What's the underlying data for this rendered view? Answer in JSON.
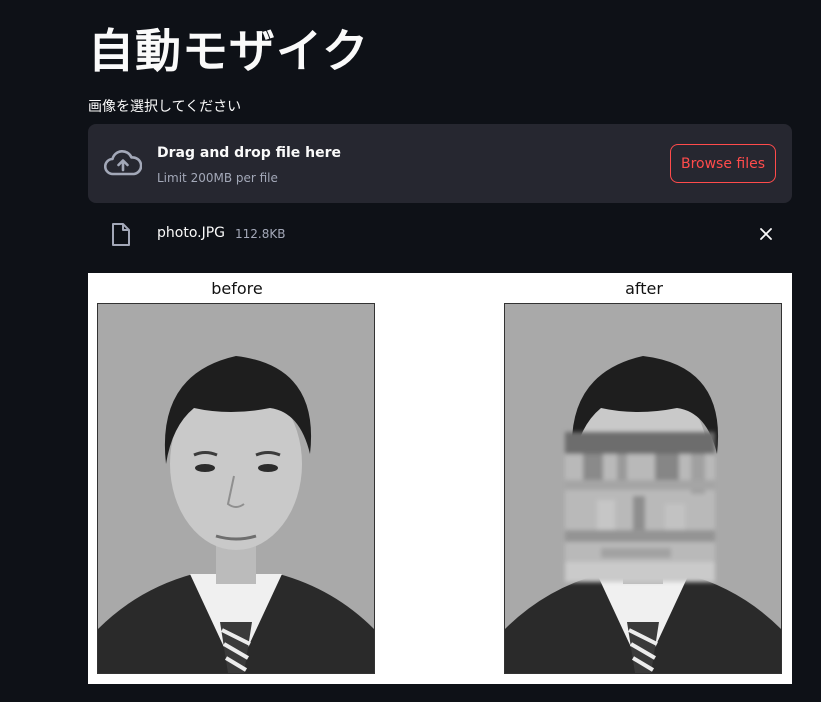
{
  "page": {
    "title": "自動モザイク"
  },
  "uploader": {
    "label": "画像を選択してください",
    "dropzone_title": "Drag and drop file here",
    "dropzone_limit": "Limit 200MB per file",
    "browse_label": "Browse files",
    "upload_icon": "cloud-upload-icon"
  },
  "uploaded_file": {
    "name": "photo.JPG",
    "size": "112.8KB",
    "file_icon": "file-icon",
    "remove_icon": "close-icon"
  },
  "figure": {
    "panels": [
      {
        "title": "before",
        "mosaic": false
      },
      {
        "title": "after",
        "mosaic": true
      }
    ]
  },
  "colors": {
    "background": "#0e1117",
    "dropzone": "#262730",
    "accent": "#ff4b4b",
    "muted_text": "#a3a8b8"
  }
}
